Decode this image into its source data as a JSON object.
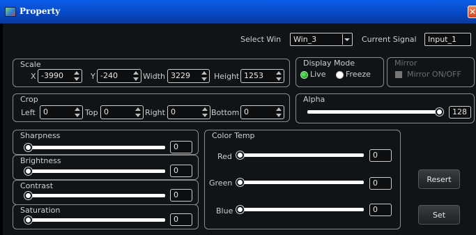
{
  "window": {
    "title": "Property",
    "close_symbol": "✕"
  },
  "top": {
    "select_win_label": "Select Win",
    "select_win_value": "Win_3",
    "current_signal_label": "Current Signal",
    "current_signal_value": "Input_1"
  },
  "scale": {
    "title": "Scale",
    "x_label": "X",
    "x_value": "-3990",
    "y_label": "Y",
    "y_value": "-240",
    "width_label": "Width",
    "width_value": "3229",
    "height_label": "Height",
    "height_value": "1253"
  },
  "display_mode": {
    "title": "Display Mode",
    "live_label": "Live",
    "freeze_label": "Freeze",
    "selected": "Live"
  },
  "mirror": {
    "title": "Mirror",
    "option_label": "Mirror ON/OFF",
    "checked": false,
    "enabled": false
  },
  "crop": {
    "title": "Crop",
    "left_label": "Left",
    "left_value": "0",
    "top_label": "Top",
    "top_value": "0",
    "right_label": "Right",
    "right_value": "0",
    "bottom_label": "Bottom",
    "bottom_value": "0"
  },
  "alpha": {
    "title": "Alpha",
    "value": "128",
    "fraction": 1.0
  },
  "picture": {
    "sharpness": {
      "label": "Sharpness",
      "value": "0",
      "fraction": 0.0
    },
    "brightness": {
      "label": "Brightness",
      "value": "0",
      "fraction": 0.0
    },
    "contrast": {
      "label": "Contrast",
      "value": "0",
      "fraction": 0.0
    },
    "saturation": {
      "label": "Saturation",
      "value": "0",
      "fraction": 0.0
    }
  },
  "color_temp": {
    "title": "Color Temp",
    "red": {
      "label": "Red",
      "value": "0",
      "fraction": 0.0
    },
    "green": {
      "label": "Green",
      "value": "0",
      "fraction": 0.0
    },
    "blue": {
      "label": "Blue",
      "value": "0",
      "fraction": 0.0
    }
  },
  "buttons": {
    "resert_label": "Resert",
    "set_label": "Set"
  },
  "colors": {
    "titlebar": "#0647c2",
    "background": "#101416",
    "accent_radio": "#19a319"
  }
}
